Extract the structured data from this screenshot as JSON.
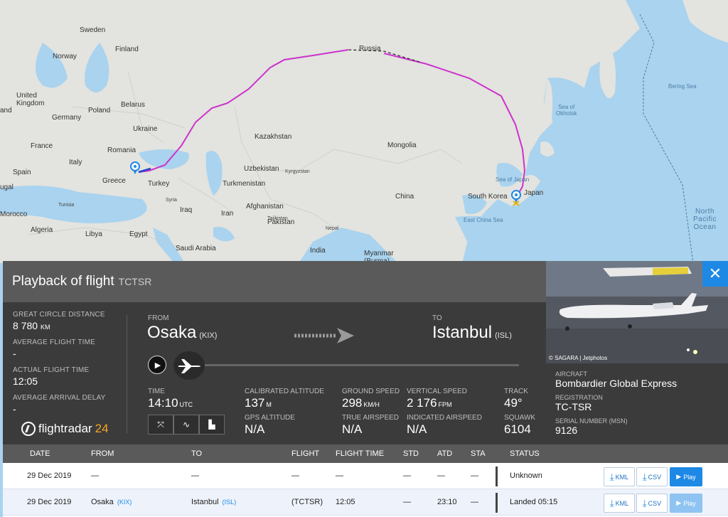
{
  "map": {
    "labels": {
      "sweden": "Sweden",
      "finland": "Finland",
      "norway": "Norway",
      "russia": "Russia",
      "united_kingdom": "United\nKingdom",
      "belarus": "Belarus",
      "poland": "Poland",
      "germany": "Germany",
      "ukraine": "Ukraine",
      "france": "France",
      "romania": "Romania",
      "italy": "Italy",
      "spain": "Spain",
      "greece": "Greece",
      "turkey": "Turkey",
      "kazakhstan": "Kazakhstan",
      "mongolia": "Mongolia",
      "uzbekistan": "Uzbekistan",
      "kyrgyzstan": "Kyrgyzstan",
      "turkmenistan": "Turkmenistan",
      "syria": "Syria",
      "iraq": "Iraq",
      "iran": "Iran",
      "afghanistan": "Afghanistan",
      "tajikistan": "Tajikistan",
      "china": "China",
      "south_korea": "South Korea",
      "japan": "Japan",
      "pakistan": "Pakistan",
      "nepal": "Nepal",
      "india": "India",
      "myanmar": "Myanmar\n(Burma)",
      "saudi_arabia": "Saudi Arabia",
      "egypt": "Egypt",
      "libya": "Libya",
      "algeria": "Algeria",
      "morocco": "Morocco",
      "tunisia": "Tunisia",
      "portugal": "ugal",
      "sea_of_okhotsk": "Sea of\nOkhotsk",
      "bering_sea": "Bering Sea",
      "sea_of_japan": "Sea of Japan",
      "east_china_sea": "East China Sea",
      "north_pacific": "North\nPacific\nOcean",
      "ireland": "and"
    }
  },
  "panel": {
    "title": "Playback of flight",
    "registration_tag": "TCTSR",
    "stats": [
      {
        "label": "Great circle distance",
        "value": "8 780",
        "unit": "KM"
      },
      {
        "label": "Average flight time",
        "value": "-",
        "unit": ""
      },
      {
        "label": "Actual flight time",
        "value": "12:05",
        "unit": ""
      },
      {
        "label": "Average arrival delay",
        "value": "-",
        "unit": ""
      }
    ],
    "logo": {
      "text": "flightradar",
      "num": "24"
    },
    "from_label": "FROM",
    "from_city": "Osaka",
    "from_code": "(KIX)",
    "to_label": "TO",
    "to_city": "Istanbul",
    "to_code": "(ISL)",
    "playback_progress": 0.0,
    "metrics": {
      "time": {
        "label": "TIME",
        "value": "14:10",
        "unit": "UTC"
      },
      "cal_alt": {
        "label": "CALIBRATED ALTITUDE",
        "value": "137",
        "unit": "M"
      },
      "gps_alt": {
        "label": "GPS ALTITUDE",
        "value": "N/A"
      },
      "ground_speed": {
        "label": "GROUND SPEED",
        "value": "298",
        "unit": "KM/H"
      },
      "true_airspeed": {
        "label": "TRUE AIRSPEED",
        "value": "N/A"
      },
      "vertical_speed": {
        "label": "VERTICAL SPEED",
        "value": "2 176",
        "unit": "FPM"
      },
      "indicated_airspeed": {
        "label": "INDICATED AIRSPEED",
        "value": "N/A"
      },
      "track": {
        "label": "TRACK",
        "value": "49°"
      },
      "squawk": {
        "label": "SQUAWK",
        "value": "6104"
      }
    }
  },
  "aircraft": {
    "photo_credit": "© SAGARA | Jetphotos",
    "aircraft_label": "AIRCRAFT",
    "aircraft_value": "Bombardier Global Express",
    "registration_label": "REGISTRATION",
    "registration_value": "TC-TSR",
    "serial_label": "SERIAL NUMBER (MSN)",
    "serial_value": "9126",
    "close": "✕"
  },
  "table": {
    "headers": [
      "DATE",
      "FROM",
      "TO",
      "FLIGHT",
      "FLIGHT TIME",
      "STD",
      "ATD",
      "STA",
      "STATUS"
    ],
    "kml_label": "KML",
    "csv_label": "CSV",
    "play_label": "Play",
    "rows": [
      {
        "date": "29 Dec 2019",
        "from": "—",
        "from_code": "",
        "to": "—",
        "to_code": "",
        "flight": "—",
        "flight_time": "—",
        "std": "—",
        "atd": "—",
        "sta": "—",
        "status": "Unknown"
      },
      {
        "date": "29 Dec 2019",
        "from": "Osaka",
        "from_code": "(KIX)",
        "to": "Istanbul",
        "to_code": "(ISL)",
        "flight": "(TCTSR)",
        "flight_time": "12:05",
        "std": "—",
        "atd": "23:10",
        "sta": "—",
        "status": "Landed 05:15"
      }
    ]
  },
  "colors": {
    "route": "#cc33cc",
    "accent": "#1e88e5",
    "panel_dark": "#3b3b3b",
    "panel_head": "#5a5a5a"
  }
}
